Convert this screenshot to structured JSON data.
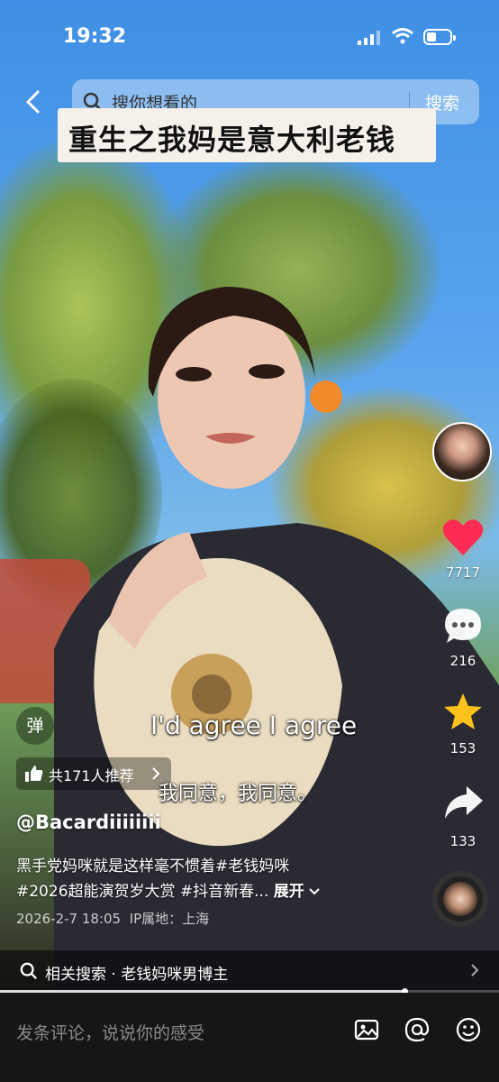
{
  "status_bar": {
    "time": "19:32",
    "battery_level": 0.4
  },
  "search": {
    "placeholder": "搜你想看的",
    "button": "搜索"
  },
  "banner_title": "重生之我妈是意大利老钱",
  "actions": {
    "likes": "7717",
    "comments": "216",
    "favorites": "153",
    "shares": "133"
  },
  "danmaku_label": "弹",
  "recommend": "共171人推荐",
  "subtitles": {
    "en": "I'd agree I agree",
    "zh": "我同意，我同意。"
  },
  "author": "@Bacardiiiiiiii",
  "description": {
    "line1": "黑手党妈咪就是这样毫不惯着#老钱妈咪",
    "line2": "#2026超能演贺岁大赏 #抖音新春...",
    "expand": "展开"
  },
  "meta": {
    "date": "2026-2-7 18:05",
    "ip": "IP属地：上海"
  },
  "related_search": "相关搜索 · 老钱妈咪男博主",
  "video_progress": 0.81,
  "comment_input": {
    "placeholder": "发条评论，说说你的感受"
  },
  "colors": {
    "like": "#fe2c55",
    "favorite": "#ffc21a"
  }
}
